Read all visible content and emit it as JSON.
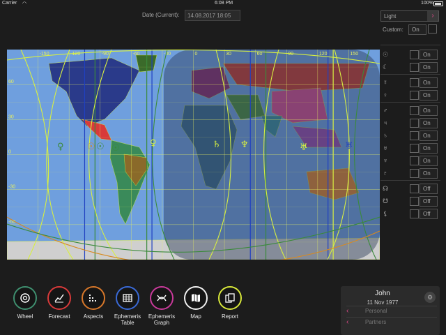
{
  "status_bar": {
    "carrier": "Carrier",
    "time": "6:08 PM",
    "battery": "100%"
  },
  "date": {
    "label": "Date (Current):",
    "value": "14.08.2017 18:05"
  },
  "settings": {
    "theme": "Light",
    "custom_label": "Custom:",
    "custom_value": "On",
    "planet_toggles": [
      {
        "symbol": "☉",
        "name": "sun",
        "value": "On"
      },
      {
        "symbol": "☾",
        "name": "moon",
        "value": "On"
      },
      {
        "symbol": "☿",
        "name": "mercury",
        "value": "On"
      },
      {
        "symbol": "♀",
        "name": "venus",
        "value": "On"
      },
      {
        "symbol": "♂",
        "name": "mars",
        "value": "On"
      },
      {
        "symbol": "♃",
        "name": "jupiter",
        "value": "On"
      },
      {
        "symbol": "♄",
        "name": "saturn",
        "value": "On"
      },
      {
        "symbol": "♅",
        "name": "uranus",
        "value": "On"
      },
      {
        "symbol": "♆",
        "name": "neptune",
        "value": "On"
      },
      {
        "symbol": "♇",
        "name": "pluto",
        "value": "On"
      },
      {
        "symbol": "☊",
        "name": "north-node",
        "value": "Off"
      },
      {
        "symbol": "☋",
        "name": "south-node",
        "value": "Off"
      },
      {
        "symbol": "⚸",
        "name": "lilith",
        "value": "Off"
      }
    ]
  },
  "map": {
    "longitude_labels": [
      "-150",
      "-120",
      "-90",
      "-60",
      "-30",
      "0",
      "30",
      "60",
      "90",
      "120",
      "150"
    ],
    "latitude_labels": [
      "60",
      "30",
      "0",
      "-30",
      "-60"
    ],
    "colors": {
      "ocean": "#6f9fde",
      "night_shade": "#2a3a56",
      "grid": "#e8f060",
      "planet_lines_yellow": "#d8f040",
      "planet_lines_green": "#3a8a3a",
      "planet_lines_blue": "#2040c0",
      "planet_lines_orange": "#d88a20"
    }
  },
  "tabs": [
    {
      "key": "wheel",
      "label": "Wheel",
      "color": "#3f8f6f"
    },
    {
      "key": "forecast",
      "label": "Forecast",
      "color": "#d83a3a"
    },
    {
      "key": "aspects",
      "label": "Aspects",
      "color": "#d8782a"
    },
    {
      "key": "ephemeris-table",
      "label": "Ephemeris Table",
      "color": "#3a6ad8"
    },
    {
      "key": "ephemeris-graph",
      "label": "Ephemeris Graph",
      "color": "#c83a9a"
    },
    {
      "key": "map",
      "label": "Map",
      "color": "#f0f0f0"
    },
    {
      "key": "report",
      "label": "Report",
      "color": "#d8e83a"
    }
  ],
  "profile": {
    "name": "John",
    "date": "11 Nov 1977",
    "personal_label": "Personal",
    "partners_label": "Partners"
  }
}
